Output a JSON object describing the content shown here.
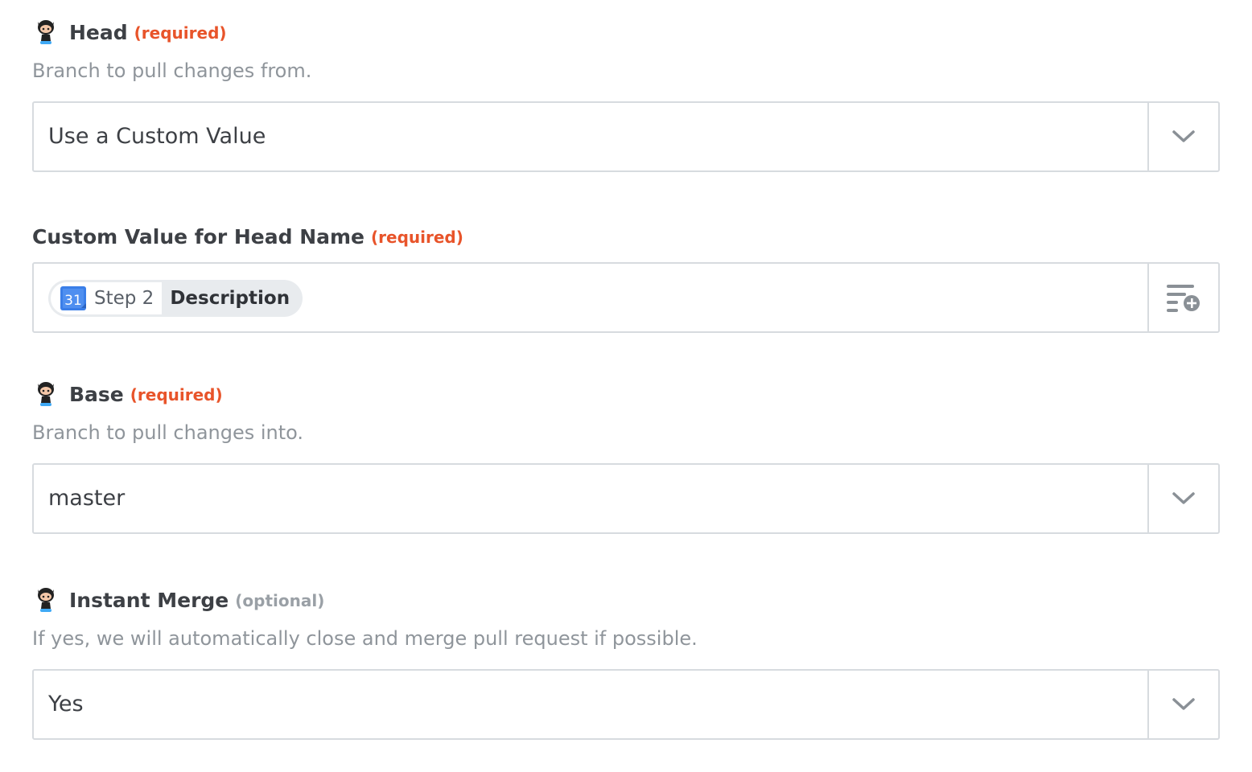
{
  "fields": {
    "head": {
      "label": "Head",
      "badge": "(required)",
      "help": "Branch to pull changes from.",
      "value": "Use a Custom Value",
      "icon": "github-octocat-icon",
      "control_icon": "chevron-down-icon"
    },
    "custom_head": {
      "label": "Custom Value for Head Name",
      "badge": "(required)",
      "token": {
        "app_icon": "google-calendar-icon",
        "app_icon_text": "31",
        "step": "Step 2",
        "field": "Description"
      },
      "control_icon": "insert-data-icon"
    },
    "base": {
      "label": "Base",
      "badge": "(required)",
      "help": "Branch to pull changes into.",
      "value": "master",
      "icon": "github-octocat-icon",
      "control_icon": "chevron-down-icon"
    },
    "instant_merge": {
      "label": "Instant Merge",
      "badge": "(optional)",
      "help": "If yes, we will automatically close and merge pull request if possible.",
      "value": "Yes",
      "icon": "github-octocat-icon",
      "control_icon": "chevron-down-icon"
    }
  },
  "colors": {
    "required": "#e8542a",
    "optional": "#9aa0a6",
    "border": "#d7dbdf",
    "calendar_blue": "#3a7ee8"
  }
}
